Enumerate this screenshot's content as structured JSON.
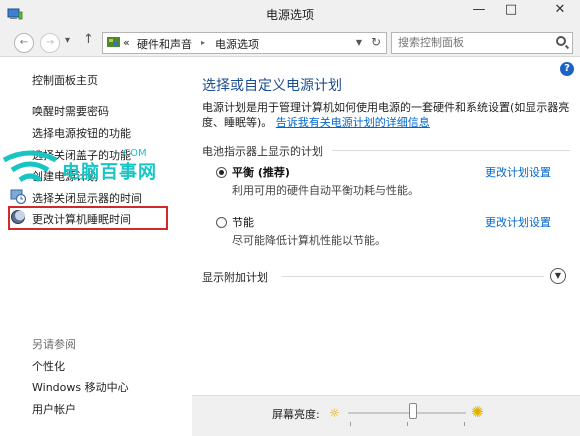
{
  "window": {
    "title": "电源选项",
    "minimize": "—",
    "maximize": "□",
    "close": "✕"
  },
  "address": {
    "crumb_prefix": "«",
    "crumb_1": "硬件和声音",
    "crumb_sep": "▸",
    "crumb_2": "电源选项",
    "search_placeholder": "搜索控制面板"
  },
  "sidebar": {
    "home": "控制面板主页",
    "items": [
      "唤醒时需要密码",
      "选择电源按钮的功能",
      "选择关闭盖子的功能",
      "创建电源计划",
      "选择关闭显示器的时间",
      "更改计算机睡眠时间"
    ],
    "see_also_label": "另请参阅",
    "see_also": [
      "个性化",
      "Windows 移动中心",
      "用户帐户"
    ]
  },
  "watermark": {
    "text": "电脑百事网",
    "domain": ".COM"
  },
  "main": {
    "title": "选择或自定义电源计划",
    "desc_text": "电源计划是用于管理计算机如何使用电源的一套硬件和系统设置(如显示器亮度、睡眠等)。",
    "desc_link": "告诉我有关电源计划的详细信息",
    "section_label": "电池指示器上显示的计划",
    "plans": [
      {
        "name": "平衡 (推荐)",
        "desc": "利用可用的硬件自动平衡功耗与性能。",
        "link": "更改计划设置",
        "selected": true
      },
      {
        "name": "节能",
        "desc": "尽可能降低计算机性能以节能。",
        "link": "更改计划设置",
        "selected": false
      }
    ],
    "more_plans": "显示附加计划"
  },
  "bottom": {
    "brightness_label": "屏幕亮度:",
    "brightness_level": 0.55
  },
  "colors": {
    "title_blue": "#1a4e8f",
    "link_blue": "#0066cc",
    "highlight_red": "#d12a2a",
    "watermark_cyan": "#18c4c4"
  }
}
